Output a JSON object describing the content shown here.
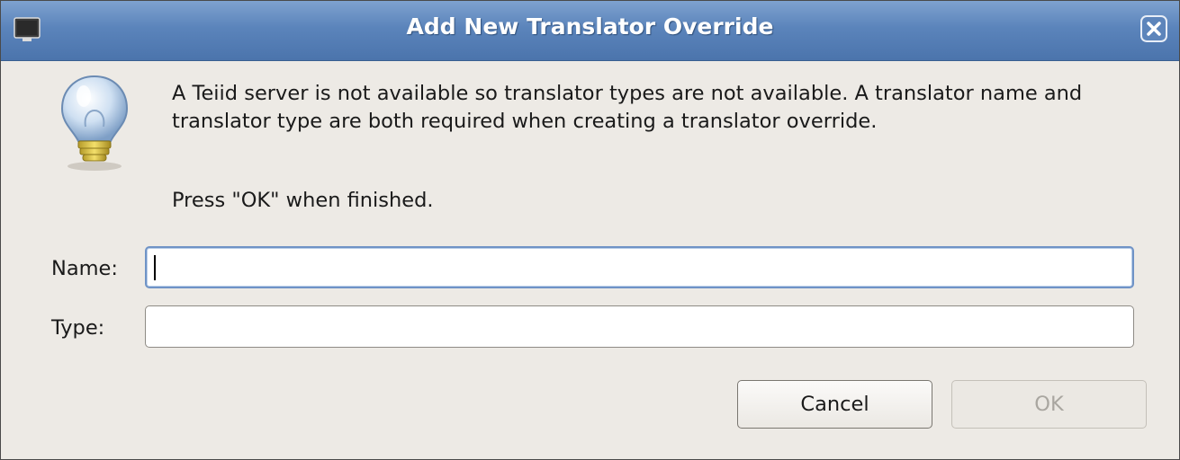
{
  "window": {
    "title": "Add New Translator Override"
  },
  "dialog": {
    "message": "A Teiid server is not available so translator types are not available. A translator name and translator type are both required when creating a translator override.",
    "hint": "Press \"OK\" when finished."
  },
  "form": {
    "name_label": "Name:",
    "name_value": "",
    "type_label": "Type:",
    "type_value": ""
  },
  "buttons": {
    "cancel_label": "Cancel",
    "ok_label": "OK",
    "ok_enabled": false
  },
  "icons": {
    "window_menu": "window-menu-icon",
    "close": "close-icon",
    "info": "lightbulb-icon"
  },
  "colors": {
    "titlebar": "#5b84bb",
    "focus_border": "#6f93c6",
    "background": "#edeae5"
  }
}
